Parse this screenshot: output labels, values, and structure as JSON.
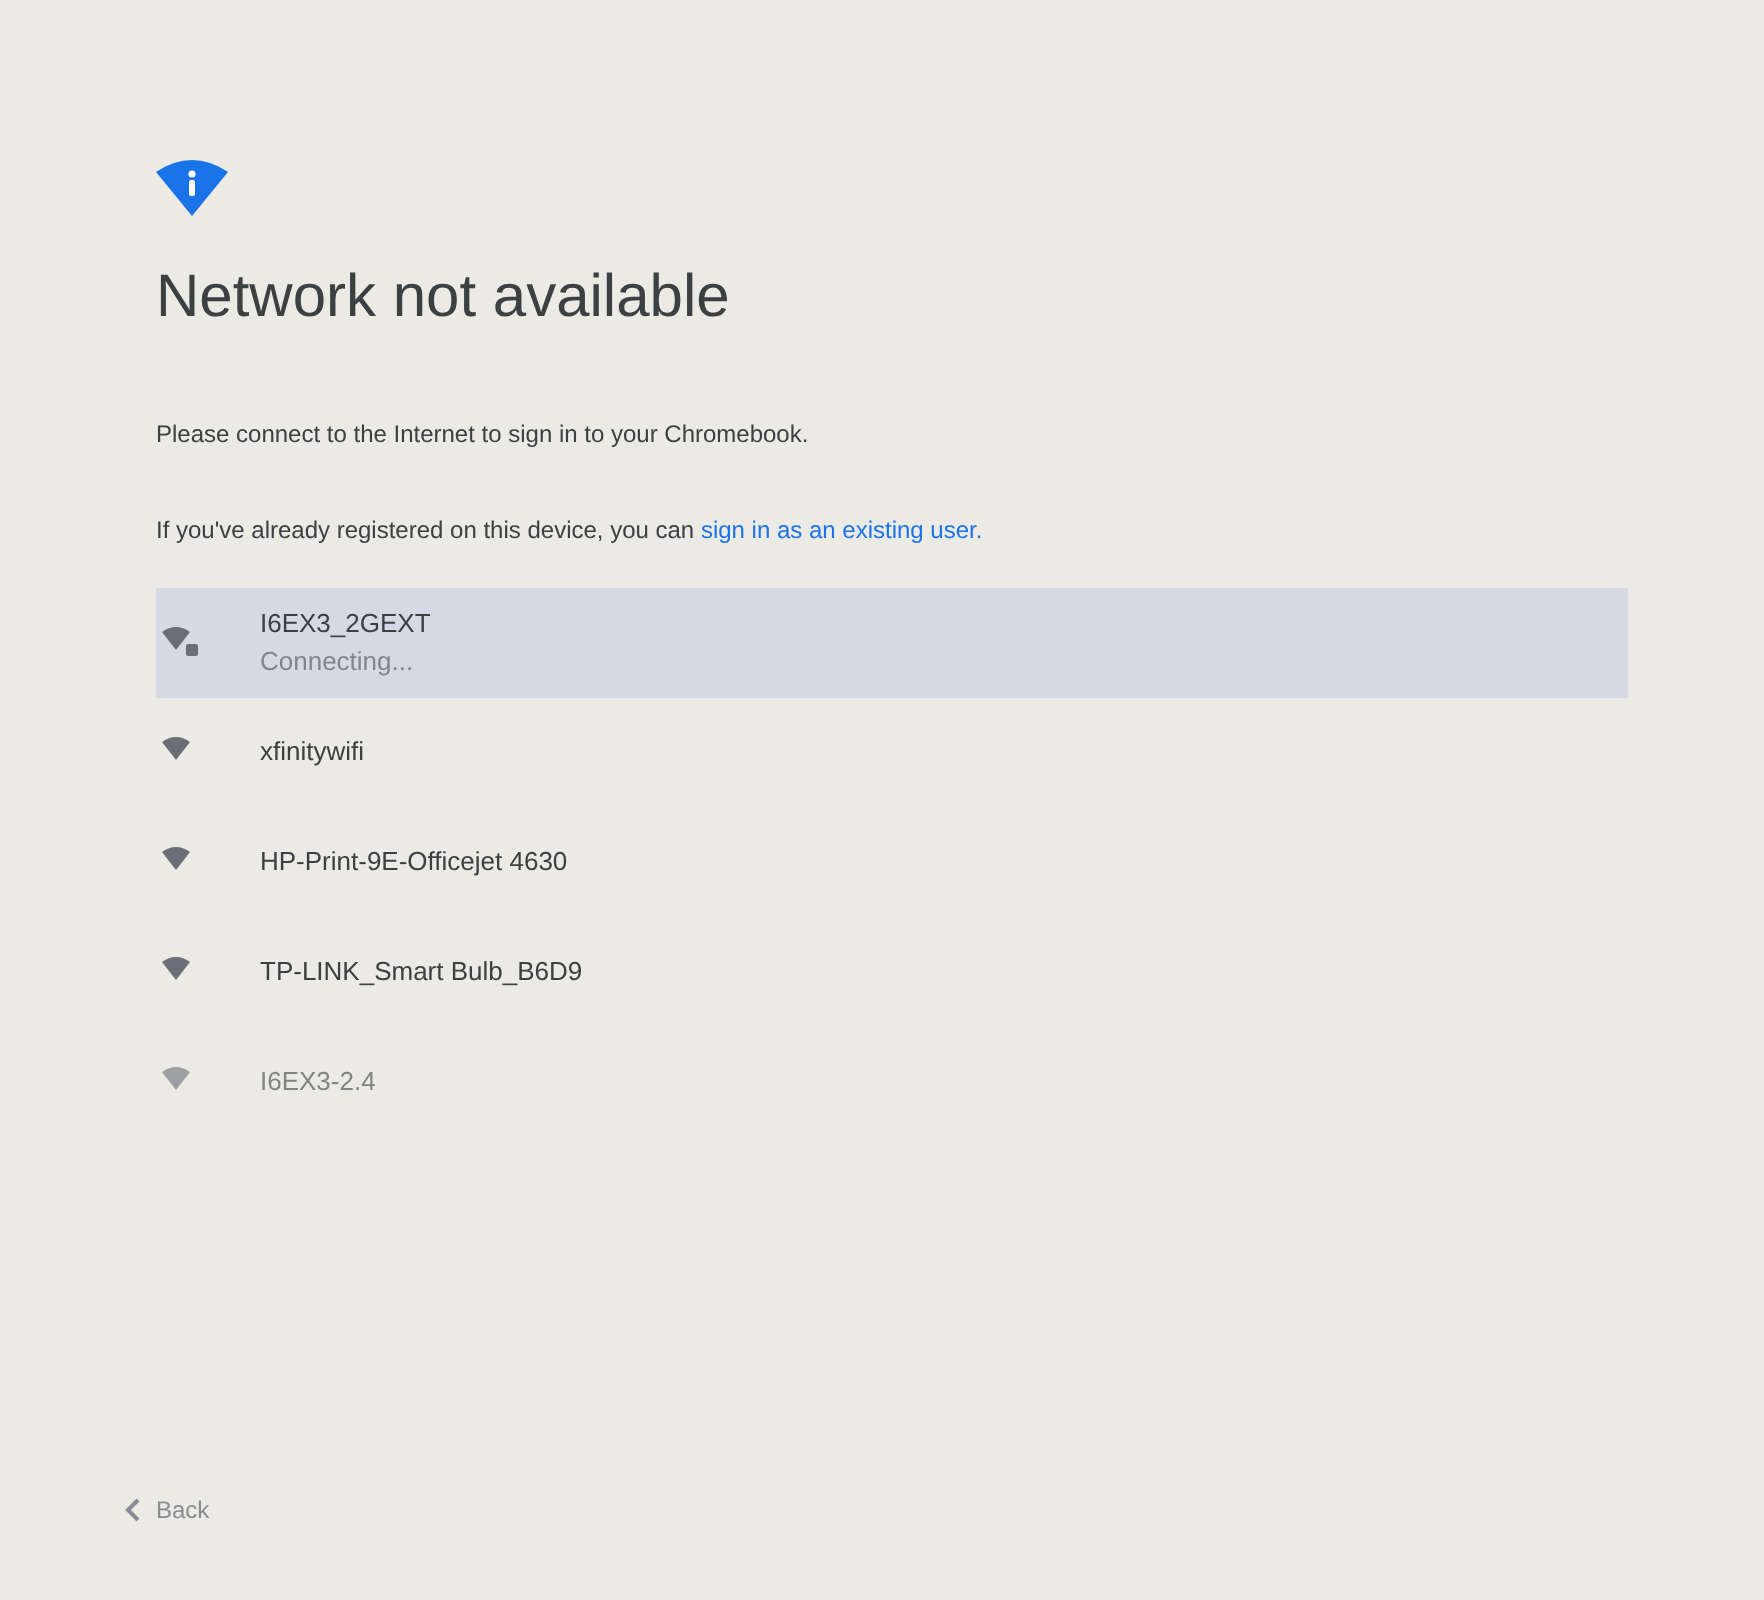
{
  "title": "Network not available",
  "message": "Please connect to the Internet to sign in to your Chromebook.",
  "registered": {
    "text": "If you've already registered on this device, you can",
    "link": "sign in as an existing user."
  },
  "networks": [
    {
      "name": "I6EX3_2GEXT",
      "status": "Connecting...",
      "selected": true,
      "secured": true
    },
    {
      "name": "xfinitywifi",
      "selected": false,
      "secured": false
    },
    {
      "name": "HP-Print-9E-Officejet 4630",
      "selected": false,
      "secured": false
    },
    {
      "name": "TP-LINK_Smart Bulb_B6D9",
      "selected": false,
      "secured": false
    },
    {
      "name": "I6EX3-2.4",
      "selected": false,
      "secured": false
    }
  ],
  "back_button": {
    "label": "Back",
    "disabled": true
  }
}
